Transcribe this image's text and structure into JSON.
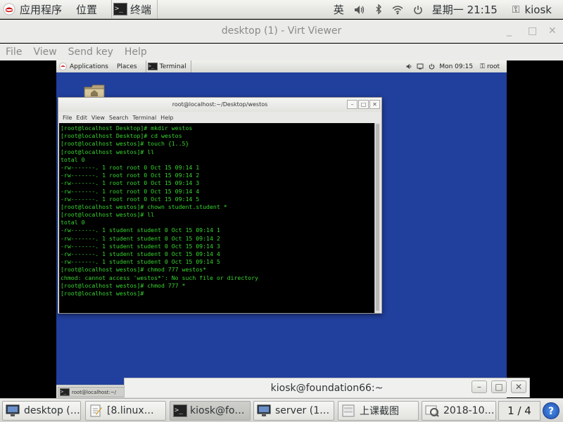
{
  "host_topbar": {
    "applications": "应用程序",
    "places": "位置",
    "active_app": "终端",
    "term_icon_glyph": ">_",
    "input_method": "英",
    "clock": "星期一 21:15",
    "user": "kiosk",
    "icons": [
      "redhat-logo-icon",
      "volume-icon",
      "bluetooth-icon",
      "wifi-icon",
      "power-icon"
    ]
  },
  "virt_viewer": {
    "title": "desktop (1) - Virt Viewer",
    "menu": [
      "File",
      "View",
      "Send key",
      "Help"
    ]
  },
  "guest": {
    "topbar": {
      "applications": "Applications",
      "places": "Places",
      "active_app": "Terminal",
      "clock": "Mon 09:15",
      "user": "root"
    },
    "terminal": {
      "title": "root@localhost:~/Desktop/westos",
      "menu": [
        "File",
        "Edit",
        "View",
        "Search",
        "Terminal",
        "Help"
      ],
      "lines": [
        "[root@localhost Desktop]# mkdir westos",
        "[root@localhost Desktop]# cd westos",
        "[root@localhost westos]# touch {1..5}",
        "[root@localhost westos]# ll",
        "total 0",
        "-rw-------. 1 root root 0 Oct 15 09:14 1",
        "-rw-------. 1 root root 0 Oct 15 09:14 2",
        "-rw-------. 1 root root 0 Oct 15 09:14 3",
        "-rw-------. 1 root root 0 Oct 15 09:14 4",
        "-rw-------. 1 root root 0 Oct 15 09:14 5",
        "[root@localhost westos]# chown student.student *",
        "[root@localhost westos]# ll",
        "total 0",
        "-rw-------. 1 student student 0 Oct 15 09:14 1",
        "-rw-------. 1 student student 0 Oct 15 09:14 2",
        "-rw-------. 1 student student 0 Oct 15 09:14 3",
        "-rw-------. 1 student student 0 Oct 15 09:14 4",
        "-rw-------. 1 student student 0 Oct 15 09:14 5",
        "[root@localhost westos]# chmod 777 westos*",
        "chmod: cannot access 'westos*': No such file or directory",
        "[root@localhost westos]# chmod 777 *",
        "[root@localhost westos]#"
      ]
    },
    "taskbar_item": "root@localhost:~/"
  },
  "kiosk_window": {
    "title": "kiosk@foundation66:~"
  },
  "host_taskbar": {
    "items": [
      "desktop (…",
      "[8.linux…",
      "kiosk@fo…",
      "server (1…",
      "上课截图",
      "2018-10…"
    ],
    "pager": "1 / 4",
    "help": "?"
  },
  "colors": {
    "guest_desktop": "#213f9c",
    "terminal_text": "#37d52f"
  }
}
